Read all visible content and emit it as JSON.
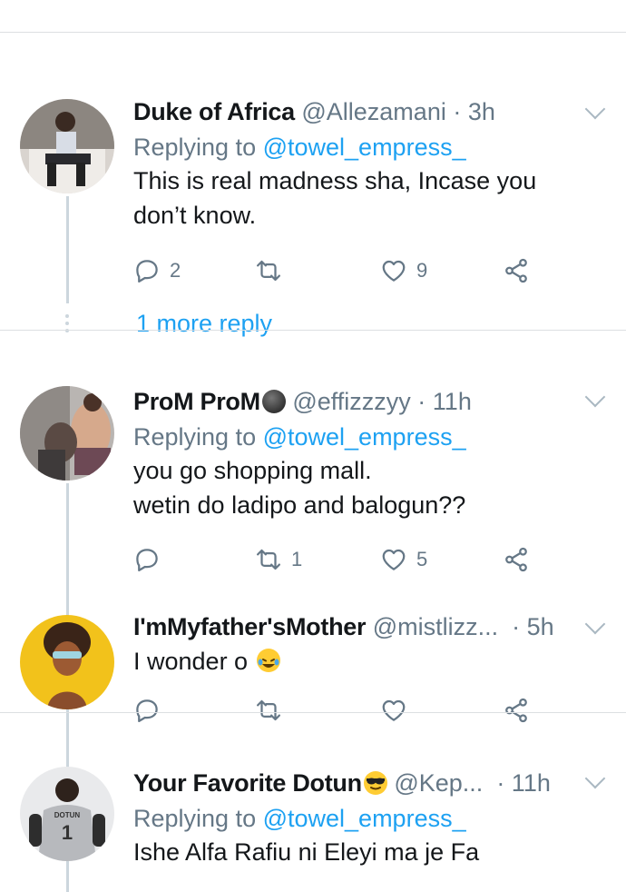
{
  "tweets": [
    {
      "name": "Duke of Africa",
      "handle": "@Allezamani",
      "time": "· 3h",
      "replying_prefix": "Replying to ",
      "replying_to": "@towel_empress_",
      "text_lines": [
        "This is real madness sha, Incase you",
        "don’t know."
      ],
      "reply_count": "2",
      "retweet_count": "",
      "like_count": "9",
      "more_reply": "1 more reply"
    },
    {
      "name": "ProM ProM",
      "handle": "@effizzzyy",
      "time": "· 11h",
      "replying_prefix": "Replying to ",
      "replying_to": "@towel_empress_",
      "text_lines": [
        "you go shopping mall.",
        "wetin do ladipo and balogun??"
      ],
      "reply_count": "",
      "retweet_count": "1",
      "like_count": "5"
    },
    {
      "name": "I'mMyfather'sMother",
      "handle": "@mistlizz...",
      "time": "· 5h",
      "text_lines": [
        "I wonder o"
      ],
      "reply_count": "",
      "retweet_count": "",
      "like_count": ""
    },
    {
      "name": "Your Favorite Dotun",
      "handle": "@Kep...",
      "time": "· 11h",
      "replying_prefix": "Replying to ",
      "replying_to": "@towel_empress_",
      "text_lines": [
        "Ishe Alfa Rafiu ni Eleyi ma je Fa"
      ]
    }
  ],
  "avatar_jersey_text": "DOTUN",
  "avatar_jersey_number": "1",
  "colors": {
    "link": "#1da1f2",
    "muted": "#657786",
    "text": "#14171a",
    "divider": "#dcdfe2",
    "thread": "#ccd6dd"
  },
  "icons": [
    "reply-icon",
    "retweet-icon",
    "like-icon",
    "share-icon",
    "chevron-down-icon",
    "laughing-emoji-icon",
    "sunglasses-emoji-icon",
    "dark-face-emoji-icon"
  ]
}
